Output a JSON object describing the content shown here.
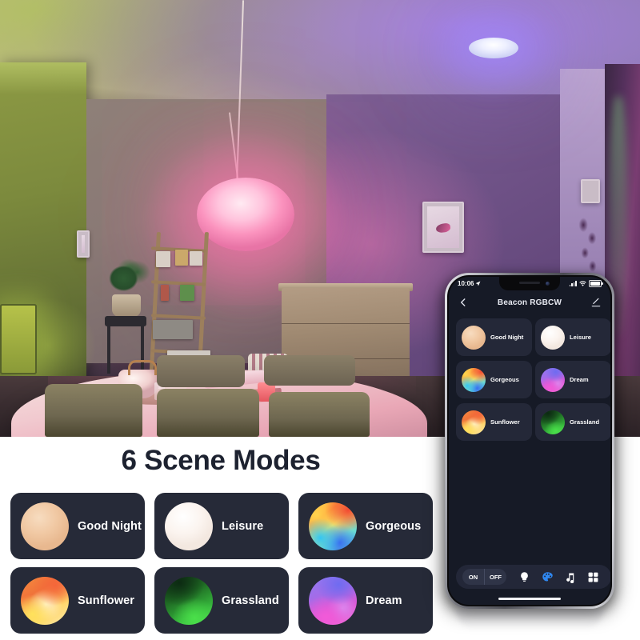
{
  "headline": "6 Scene Modes",
  "scene_modes": [
    {
      "name": "Good Night",
      "swatch": "sw-goodnight",
      "color": "#F1C9A4"
    },
    {
      "name": "Leisure",
      "swatch": "sw-leisure",
      "color": "#FBF4EF"
    },
    {
      "name": "Gorgeous",
      "swatch": "sw-gorgeous",
      "color": "#FFD84A"
    },
    {
      "name": "Sunflower",
      "swatch": "sw-sunflower",
      "color": "#F58B3E"
    },
    {
      "name": "Grassland",
      "swatch": "sw-grassland",
      "color": "#34B03A"
    },
    {
      "name": "Dream",
      "swatch": "sw-dream",
      "color": "#E056D4"
    }
  ],
  "phone": {
    "status_bar": {
      "time": "10:06",
      "location_icon": "location-arrow-icon",
      "signal_icon": "cellular-signal-icon",
      "wifi_icon": "wifi-icon",
      "battery_icon": "battery-full-icon"
    },
    "nav": {
      "back_icon": "chevron-left-icon",
      "title": "Beacon RGBCW",
      "edit_icon": "pencil-edit-icon"
    },
    "tiles": [
      {
        "name": "Good Night",
        "swatch": "sw-goodnight"
      },
      {
        "name": "Leisure",
        "swatch": "sw-leisure"
      },
      {
        "name": "Gorgeous",
        "swatch": "sw-gorgeous"
      },
      {
        "name": "Dream",
        "swatch": "sw-dream"
      },
      {
        "name": "Sunflower",
        "swatch": "sw-sunflower"
      },
      {
        "name": "Grassland",
        "swatch": "sw-grassland"
      }
    ],
    "dock": {
      "on_label": "ON",
      "off_label": "OFF",
      "icons": [
        {
          "name": "bulb-icon",
          "active": false
        },
        {
          "name": "palette-icon",
          "active": true
        },
        {
          "name": "music-icon",
          "active": false
        },
        {
          "name": "grid-icon",
          "active": false
        }
      ],
      "active_color": "#2F87F0"
    }
  },
  "theme": {
    "panel_background": "#FFFFFF",
    "card_background": "#262A38",
    "card_text": "#FFFFFF",
    "headline_color": "#1D2230",
    "phone_screen_background": "#161A26",
    "phone_tile_background": "#242838"
  }
}
